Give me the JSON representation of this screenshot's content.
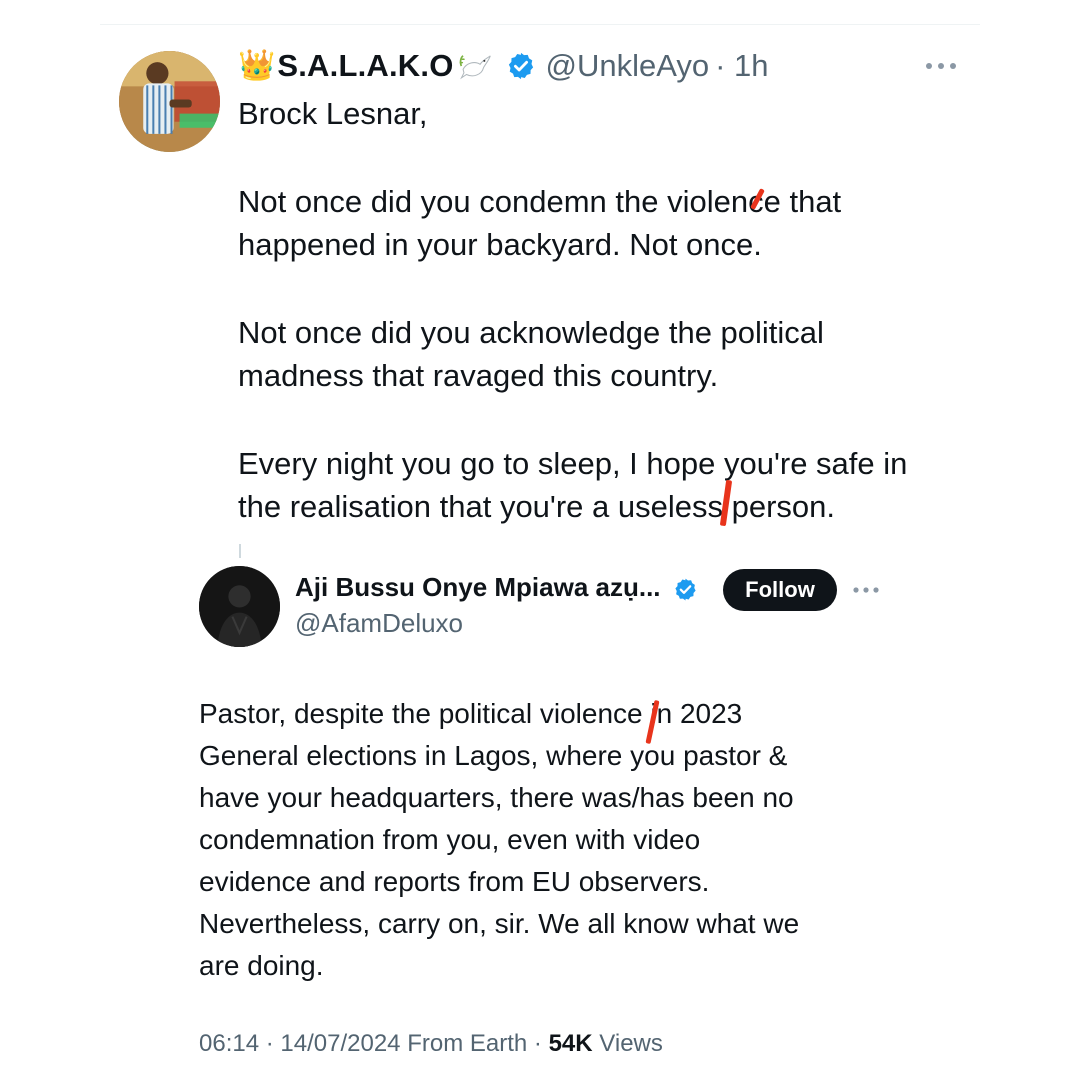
{
  "parent_tweet": {
    "display_name": "S.A.L.A.K.O",
    "crown_emoji": "👑",
    "handle": "@UnkleAyo",
    "time": "· 1h",
    "lines": [
      "Brock Lesnar,",
      "",
      "Not once did you condemn the violence that",
      "happened in your backyard. Not once.",
      "",
      "Not once did you acknowledge the political",
      "madness that ravaged this country.",
      "",
      "Every night you go to sleep, I hope you're safe in",
      "the realisation that you're a useless person."
    ],
    "icons": {
      "avatar": "avatar-photo",
      "verified": "verified-badge-icon",
      "dove": "dove-emoji-icon",
      "more": "more-options-icon"
    }
  },
  "reply_tweet": {
    "display_name": "Aji Bussu Onye Mpiawa azụ...",
    "handle": "@AfamDeluxo",
    "follow_label": "Follow",
    "lines": [
      "Pastor, despite the political violence in 2023",
      "General elections in Lagos, where you pastor &",
      "have your headquarters, there was/has been no",
      "condemnation from you, even with video",
      "evidence and reports from EU observers.",
      "Nevertheless, carry on, sir. We all know what we",
      "are doing."
    ],
    "meta": {
      "time": "06:14",
      "date": "14/07/2024",
      "source": "From Earth",
      "views_count": "54K",
      "views_label": "Views"
    }
  },
  "colors": {
    "text": "#0f1419",
    "secondary": "#536471",
    "verified": "#1d9bf0",
    "follow_bg": "#0f1419",
    "annotation_mark": "#e8341c"
  }
}
